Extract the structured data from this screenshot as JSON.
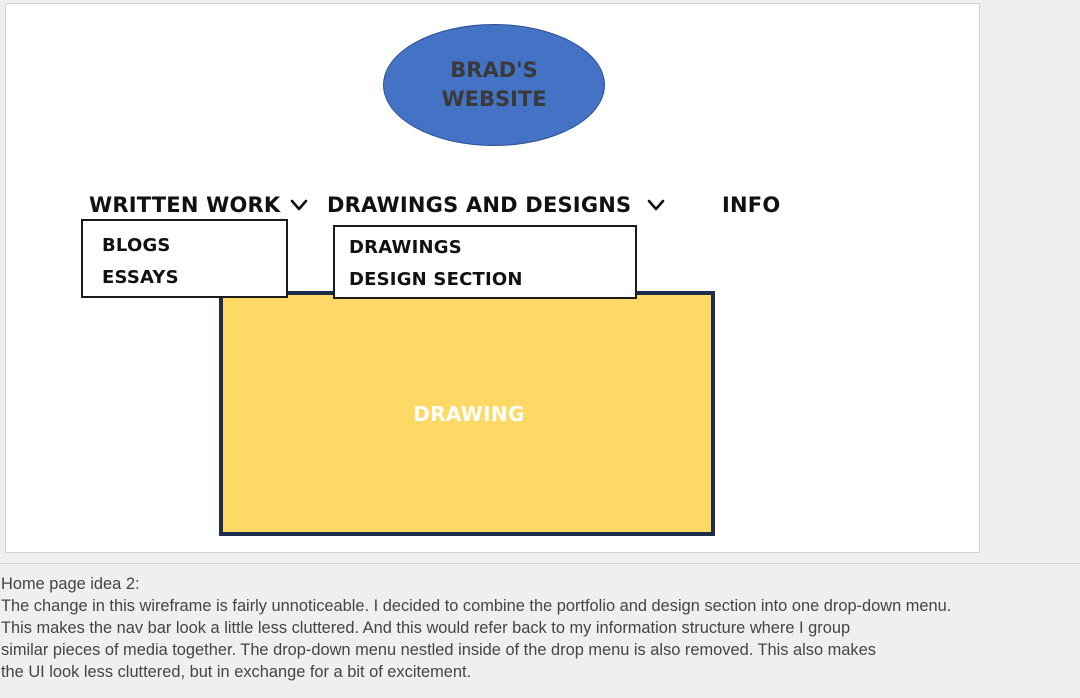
{
  "slide": {
    "logo": {
      "text": "BRAD'S\nWEBSITE"
    },
    "nav": {
      "items": [
        {
          "label": "WRITTEN WORK",
          "has_dropdown": true
        },
        {
          "label": "DRAWINGS AND DESIGNS",
          "has_dropdown": true
        },
        {
          "label": "INFO",
          "has_dropdown": false
        }
      ]
    },
    "dropdowns": {
      "written_work": [
        "BLOGS",
        "ESSAYS"
      ],
      "drawings_and_designs": [
        "DRAWINGS",
        "DESIGN SECTION"
      ]
    },
    "content": {
      "label": "DRAWING"
    }
  },
  "notes": {
    "lines": [
      "Home page idea 2:",
      "The change in this wireframe is fairly unnoticeable. I decided to combine the portfolio and design section into one drop-down menu.",
      "This makes the nav bar look a little less cluttered. And this would refer back to my information structure where I group",
      "similar pieces of media together. The drop-down menu nestled inside of the drop menu is also removed. This also makes",
      "the UI look less cluttered, but in exchange for a bit of excitement."
    ]
  },
  "colors": {
    "logo_fill": "#4472c4",
    "content_fill": "#ffd966",
    "content_border": "#1f2d4d",
    "background": "#efefef"
  },
  "icons": {
    "dropdown_indicator": "chevron-down-icon"
  }
}
